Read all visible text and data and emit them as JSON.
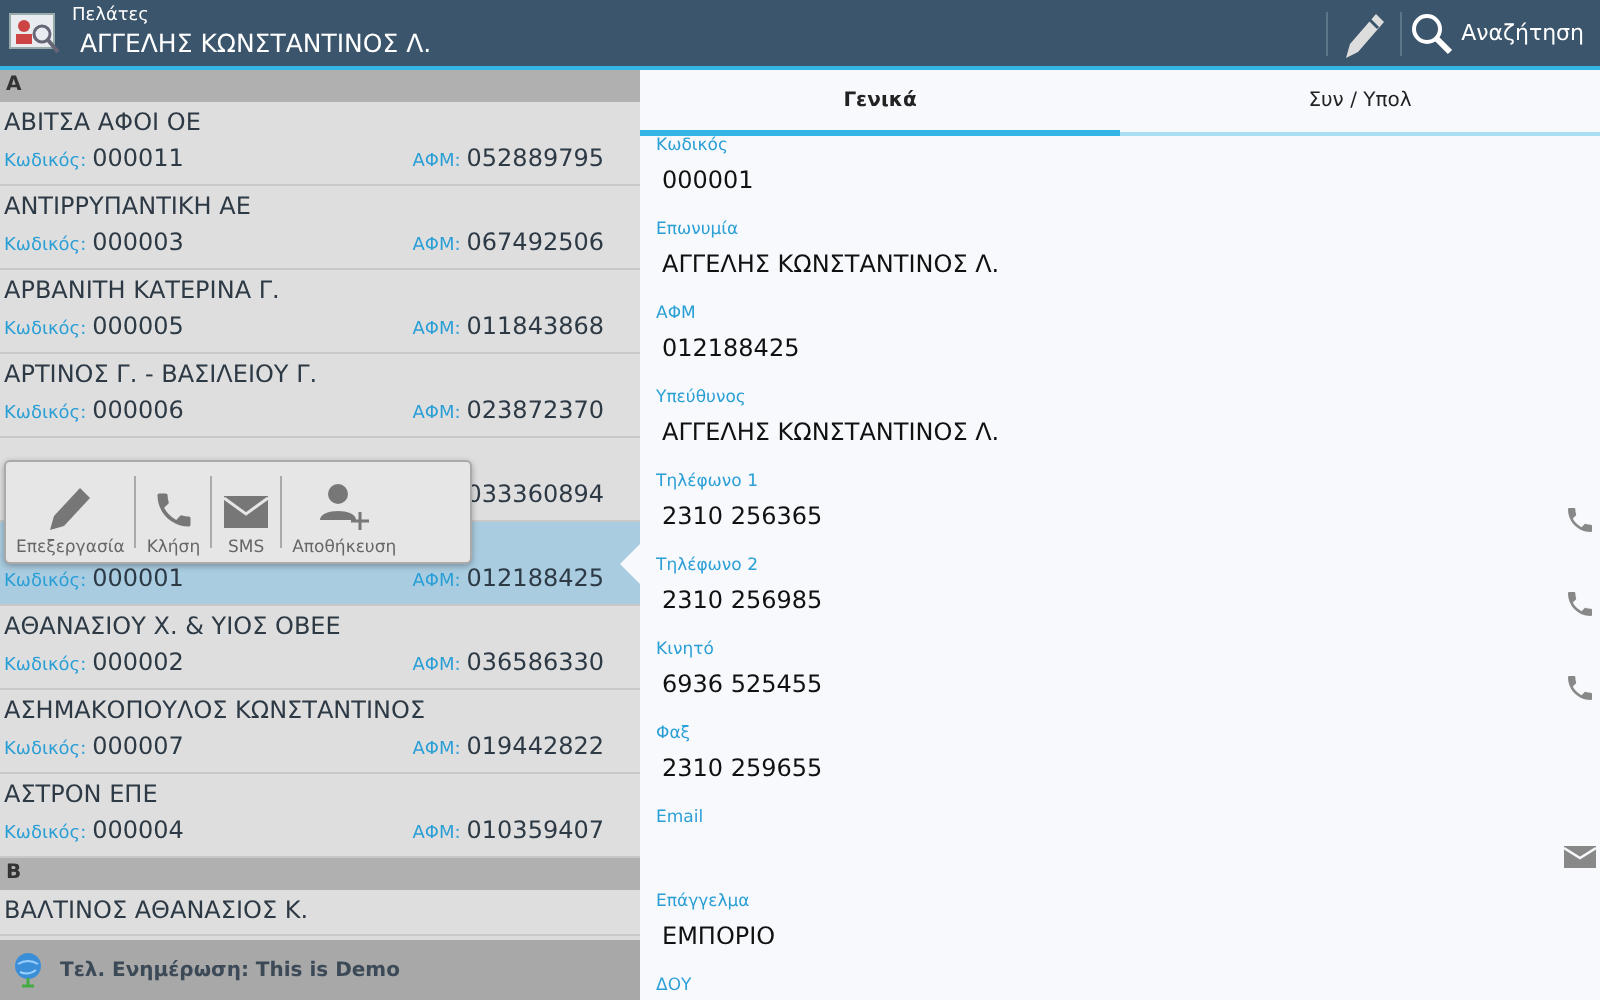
{
  "header": {
    "section": "Πελάτες",
    "title": "ΑΓΓΕΛΗΣ ΚΩΝΣΤΑΝΤΙΝΟΣ Λ.",
    "search_label": "Αναζήτηση"
  },
  "list": {
    "groups": [
      {
        "letter": "Α",
        "rows": [
          {
            "name": "ΑΒΙΤΣΑ ΑΦΟΙ ΟΕ",
            "code_label": "Κωδικός:",
            "code": "000011",
            "afm_label": "ΑΦΜ:",
            "afm": "052889795",
            "selected": false
          },
          {
            "name": "ΑΝΤΙΡΡΥΠΑΝΤΙΚΗ ΑΕ",
            "code_label": "Κωδικός:",
            "code": "000003",
            "afm_label": "ΑΦΜ:",
            "afm": "067492506",
            "selected": false
          },
          {
            "name": "ΑΡΒΑΝΙΤΗ ΚΑΤΕΡΙΝΑ Γ.",
            "code_label": "Κωδικός:",
            "code": "000005",
            "afm_label": "ΑΦΜ:",
            "afm": "011843868",
            "selected": false
          },
          {
            "name": "ΑΡΤΙΝΟΣ Γ. - ΒΑΣΙΛΕΙΟΥ Γ.",
            "code_label": "Κωδικός:",
            "code": "000006",
            "afm_label": "ΑΦΜ:",
            "afm": "023872370",
            "selected": false
          },
          {
            "afm": "033360894",
            "selected": false
          },
          {
            "code_label": "Κωδικός:",
            "code": "000001",
            "afm_label": "ΑΦΜ:",
            "afm": "012188425",
            "selected": true
          },
          {
            "name": "ΑΘΑΝΑΣΙΟΥ  Χ. & ΥΙΟΣ ΟΒΕΕ",
            "code_label": "Κωδικός:",
            "code": "000002",
            "afm_label": "ΑΦΜ:",
            "afm": "036586330",
            "selected": false
          },
          {
            "name": "ΑΣΗΜΑΚΟΠΟΥΛΟΣ ΚΩΝΣΤΑΝΤΙΝΟΣ",
            "code_label": "Κωδικός:",
            "code": "000007",
            "afm_label": "ΑΦΜ:",
            "afm": "019442822",
            "selected": false
          },
          {
            "name": "ΑΣΤΡΟΝ ΕΠΕ",
            "code_label": "Κωδικός:",
            "code": "000004",
            "afm_label": "ΑΦΜ:",
            "afm": "010359407",
            "selected": false
          }
        ]
      },
      {
        "letter": "Β",
        "rows": [
          {
            "name": "ΒΑΛΤΙΝΟΣ ΑΘΑΝΑΣΙΟΣ Κ.",
            "selected": false
          }
        ]
      }
    ]
  },
  "popup": {
    "actions": [
      {
        "kind": "edit",
        "label": "Επεξεργασία"
      },
      {
        "kind": "call",
        "label": "Κλήση"
      },
      {
        "kind": "sms",
        "label": "SMS"
      },
      {
        "kind": "save",
        "label": "Αποθήκευση"
      }
    ]
  },
  "status_bar": {
    "text": "Τελ. Ενημέρωση: This is Demo"
  },
  "tabs": [
    {
      "label": "Γενικά",
      "selected": true
    },
    {
      "label": "Συν / Υπολ",
      "selected": false
    }
  ],
  "fields": [
    {
      "kind": "text",
      "label": "Κωδικός",
      "value": "000001"
    },
    {
      "kind": "text",
      "label": "Επωνυμία",
      "value": "ΑΓΓΕΛΗΣ ΚΩΝΣΤΑΝΤΙΝΟΣ Λ."
    },
    {
      "kind": "text",
      "label": "ΑΦΜ",
      "value": "012188425"
    },
    {
      "kind": "text",
      "label": "Υπεύθυνος",
      "value": "ΑΓΓΕΛΗΣ ΚΩΝΣΤΑΝΤΙΝΟΣ Λ."
    },
    {
      "kind": "phone",
      "label": "Τηλέφωνο 1",
      "value": "2310 256365"
    },
    {
      "kind": "phone",
      "label": "Τηλέφωνο 2",
      "value": "2310 256985"
    },
    {
      "kind": "phone",
      "label": "Κινητό",
      "value": "6936 525455"
    },
    {
      "kind": "text",
      "label": "Φαξ",
      "value": "2310 259655"
    },
    {
      "kind": "email",
      "label": "Email"
    },
    {
      "kind": "text",
      "label": "Επάγγελμα",
      "value": "ΕΜΠΟΡΙΟ"
    },
    {
      "kind": "text",
      "label": "ΔΟΥ"
    }
  ]
}
